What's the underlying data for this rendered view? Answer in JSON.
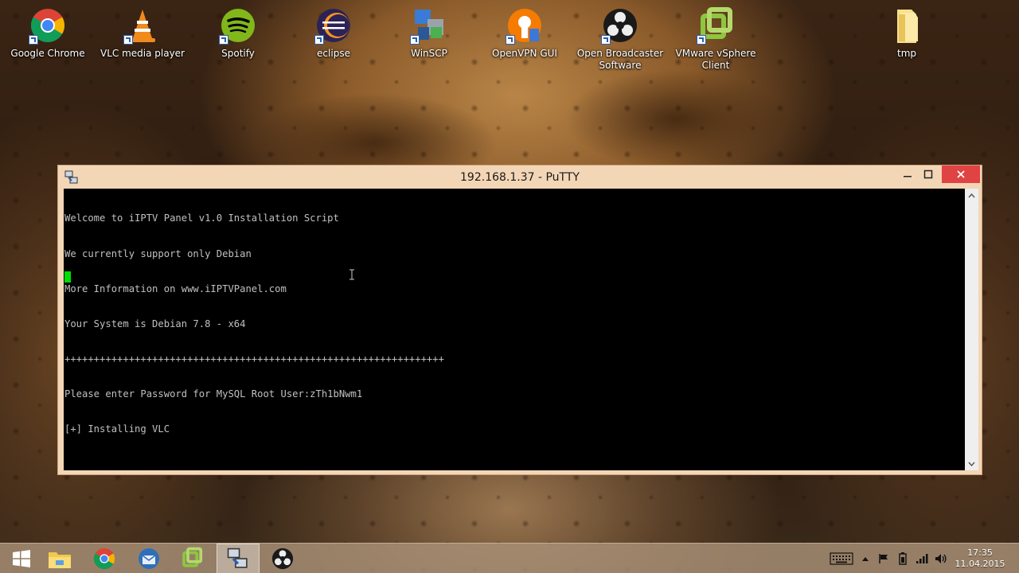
{
  "desktop": {
    "icons": [
      {
        "label": "Google Chrome",
        "icon": "chrome-icon"
      },
      {
        "label": "VLC media player",
        "icon": "vlc-icon"
      },
      {
        "label": "Spotify",
        "icon": "spotify-icon"
      },
      {
        "label": "eclipse",
        "icon": "eclipse-icon"
      },
      {
        "label": "WinSCP",
        "icon": "winscp-icon"
      },
      {
        "label": "OpenVPN GUI",
        "icon": "openvpn-icon"
      },
      {
        "label": "Open Broadcaster Software",
        "icon": "obs-icon"
      },
      {
        "label": "VMware vSphere Client",
        "icon": "vsphere-icon"
      },
      {
        "label": "tmp",
        "icon": "folder-icon"
      }
    ]
  },
  "putty": {
    "title": "192.168.1.37 - PuTTY",
    "terminal_lines": [
      "Welcome to iIPTV Panel v1.0 Installation Script",
      "We currently support only Debian",
      "More Information on www.iIPTVPanel.com",
      "Your System is Debian 7.8 - x64",
      "+++++++++++++++++++++++++++++++++++++++++++++++++++++++++++++++++",
      "Please enter Password for MySQL Root User:zTh1bNwm1",
      "[+] Installing VLC"
    ],
    "cursor_color": "#00e000"
  },
  "taskbar": {
    "items": [
      {
        "icon": "start-windows-icon"
      },
      {
        "icon": "file-explorer-icon"
      },
      {
        "icon": "chrome-icon"
      },
      {
        "icon": "thunderbird-icon"
      },
      {
        "icon": "vsphere-icon"
      },
      {
        "icon": "putty-icon",
        "active": true
      },
      {
        "icon": "obs-icon"
      }
    ],
    "tray": [
      "keyboard-icon",
      "show-hidden-icons-chevron",
      "action-center-flag-icon",
      "power-icon",
      "network-signal-icon",
      "volume-icon"
    ],
    "clock": {
      "time": "17:35",
      "date": "11.04.2015"
    }
  },
  "colors": {
    "window_frame": "#f3d6b6",
    "close_button": "#e04343",
    "terminal_bg": "#000000",
    "terminal_fg": "#c0c0c0"
  }
}
